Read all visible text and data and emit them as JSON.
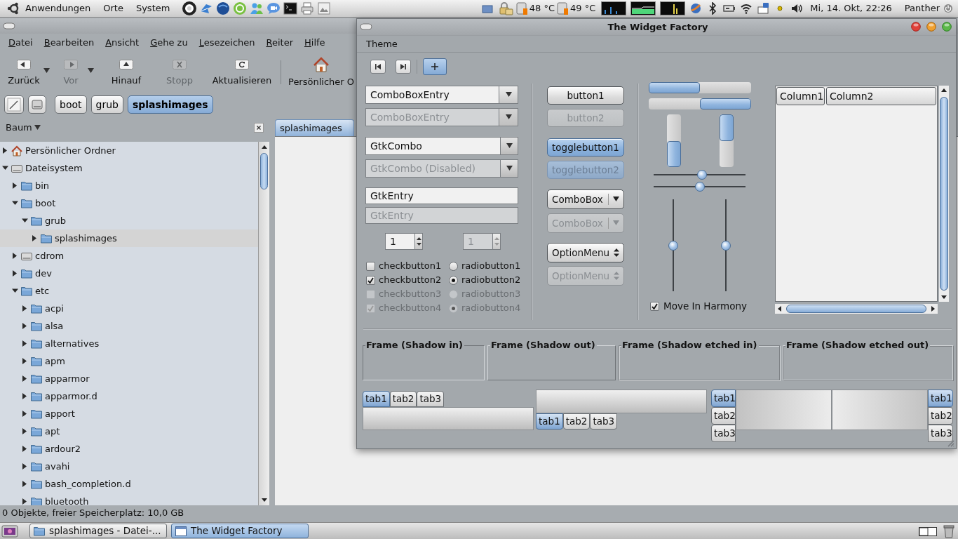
{
  "top_panel": {
    "menus": [
      "Anwendungen",
      "Orte",
      "System"
    ],
    "sensors": [
      "48 °C",
      "49 °C"
    ],
    "clock": "Mi, 14. Okt, 22:26",
    "user": "Panther"
  },
  "file_manager": {
    "menu": [
      "Datei",
      "Bearbeiten",
      "Ansicht",
      "Gehe zu",
      "Lesezeichen",
      "Reiter",
      "Hilfe"
    ],
    "toolbar": [
      {
        "kind": "back",
        "label": "Zurück",
        "disabled": false,
        "dropdown": true
      },
      {
        "kind": "forward",
        "label": "Vor",
        "disabled": true,
        "dropdown": true
      },
      {
        "kind": "up",
        "label": "Hinauf",
        "disabled": false,
        "dropdown": false
      },
      {
        "kind": "stop",
        "label": "Stopp",
        "disabled": true,
        "dropdown": false
      },
      {
        "kind": "reload",
        "label": "Aktualisieren",
        "disabled": false,
        "dropdown": false
      },
      {
        "kind": "home",
        "label": "Persönlicher O",
        "disabled": false,
        "dropdown": false
      }
    ],
    "path": [
      {
        "label": "boot",
        "selected": false
      },
      {
        "label": "grub",
        "selected": false
      },
      {
        "label": "splashimages",
        "selected": true
      }
    ],
    "sidebar": {
      "title": "Baum",
      "tree": [
        {
          "label": "Persönlicher Ordner",
          "kind": "home",
          "expanded": false,
          "selected": false
        },
        {
          "label": "Dateisystem",
          "kind": "drive",
          "expanded": true,
          "selected": false,
          "children": [
            {
              "label": "bin",
              "kind": "folder",
              "expanded": false,
              "selected": false
            },
            {
              "label": "boot",
              "kind": "folder",
              "expanded": true,
              "selected": false,
              "children": [
                {
                  "label": "grub",
                  "kind": "folder",
                  "expanded": true,
                  "selected": false,
                  "children": [
                    {
                      "label": "splashimages",
                      "kind": "folder",
                      "expanded": false,
                      "selected": true
                    }
                  ]
                }
              ]
            },
            {
              "label": "cdrom",
              "kind": "drive",
              "expanded": false,
              "selected": false
            },
            {
              "label": "dev",
              "kind": "folder",
              "expanded": false,
              "selected": false
            },
            {
              "label": "etc",
              "kind": "folder",
              "expanded": true,
              "selected": false,
              "children": [
                {
                  "label": "acpi",
                  "kind": "folder",
                  "expanded": false,
                  "selected": false
                },
                {
                  "label": "alsa",
                  "kind": "folder",
                  "expanded": false,
                  "selected": false
                },
                {
                  "label": "alternatives",
                  "kind": "folder",
                  "expanded": false,
                  "selected": false
                },
                {
                  "label": "apm",
                  "kind": "folder",
                  "expanded": false,
                  "selected": false
                },
                {
                  "label": "apparmor",
                  "kind": "folder",
                  "expanded": false,
                  "selected": false
                },
                {
                  "label": "apparmor.d",
                  "kind": "folder",
                  "expanded": false,
                  "selected": false
                },
                {
                  "label": "apport",
                  "kind": "folder",
                  "expanded": false,
                  "selected": false
                },
                {
                  "label": "apt",
                  "kind": "folder",
                  "expanded": false,
                  "selected": false
                },
                {
                  "label": "ardour2",
                  "kind": "folder",
                  "expanded": false,
                  "selected": false
                },
                {
                  "label": "avahi",
                  "kind": "folder",
                  "expanded": false,
                  "selected": false
                },
                {
                  "label": "bash_completion.d",
                  "kind": "folder",
                  "expanded": false,
                  "selected": false
                },
                {
                  "label": "bluetooth",
                  "kind": "folder",
                  "expanded": false,
                  "selected": false
                }
              ]
            }
          ]
        }
      ]
    },
    "tab": "splashimages",
    "status": "0 Objekte, freier Speicherplatz: 10,0 GB"
  },
  "widget_factory": {
    "title": "The Widget Factory",
    "menu": [
      "Theme"
    ],
    "toolbar": [
      {
        "kind": "first",
        "pressed": false
      },
      {
        "kind": "last",
        "pressed": false
      },
      {
        "kind": "add",
        "pressed": true
      }
    ],
    "combos": [
      {
        "kind": "combo_entry",
        "value": "ComboBoxEntry",
        "disabled": false
      },
      {
        "kind": "combo_entry",
        "value": "ComboBoxEntry",
        "disabled": true
      },
      {
        "kind": "combo",
        "value": "GtkCombo",
        "disabled": false
      },
      {
        "kind": "combo",
        "value": "GtkCombo (Disabled)",
        "disabled": true
      }
    ],
    "entries": [
      {
        "value": "GtkEntry",
        "disabled": false
      },
      {
        "value": "GtkEntry",
        "disabled": true
      }
    ],
    "spinners": [
      {
        "value": "1",
        "disabled": false
      },
      {
        "value": "1",
        "disabled": true
      }
    ],
    "checkbuttons": [
      {
        "label": "checkbutton1",
        "checked": false,
        "disabled": false
      },
      {
        "label": "checkbutton2",
        "checked": true,
        "disabled": false
      },
      {
        "label": "checkbutton3",
        "checked": false,
        "disabled": true
      },
      {
        "label": "checkbutton4",
        "checked": true,
        "disabled": true
      }
    ],
    "radiobuttons": [
      {
        "label": "radiobutton1",
        "selected": false,
        "disabled": false
      },
      {
        "label": "radiobutton2",
        "selected": true,
        "disabled": false
      },
      {
        "label": "radiobutton3",
        "selected": false,
        "disabled": true
      },
      {
        "label": "radiobutton4",
        "selected": true,
        "disabled": true
      }
    ],
    "buttons": [
      {
        "kind": "button",
        "label": "button1",
        "disabled": false,
        "pressed": false
      },
      {
        "kind": "button",
        "label": "button2",
        "disabled": true,
        "pressed": false
      },
      {
        "kind": "toggle",
        "label": "togglebutton1",
        "disabled": false,
        "pressed": true
      },
      {
        "kind": "toggle",
        "label": "togglebutton2",
        "disabled": true,
        "pressed": true
      },
      {
        "kind": "combobox",
        "label": "ComboBox",
        "disabled": false,
        "pressed": false
      },
      {
        "kind": "combobox",
        "label": "ComboBox",
        "disabled": true,
        "pressed": false
      },
      {
        "kind": "optionmenu",
        "label": "OptionMenu",
        "disabled": false,
        "pressed": false
      },
      {
        "kind": "optionmenu",
        "label": "OptionMenu",
        "disabled": true,
        "pressed": false
      }
    ],
    "progress_bars": [
      {
        "kind": "horizontal",
        "inverted": false,
        "level": 0.5
      },
      {
        "kind": "horizontal",
        "inverted": true,
        "level": 0.5
      },
      {
        "kind": "vertical",
        "inverted": true,
        "level": 0.5
      },
      {
        "kind": "vertical",
        "inverted": false,
        "level": 0.5
      }
    ],
    "scales": [
      {
        "kind": "horizontal",
        "level": 0.53
      },
      {
        "kind": "horizontal",
        "level": 0.5
      },
      {
        "kind": "vertical",
        "level": 0.5
      },
      {
        "kind": "vertical",
        "level": 0.5
      }
    ],
    "harmony": {
      "label": "Move In Harmony",
      "checked": true
    },
    "tree_view": {
      "columns": [
        "Column1",
        "Column2"
      ]
    },
    "frames": [
      {
        "label": "Frame (Shadow in)",
        "kind": "in"
      },
      {
        "label": "Frame (Shadow out)",
        "kind": "out"
      },
      {
        "label": "Frame (Shadow etched in)",
        "kind": "etched_in"
      },
      {
        "label": "Frame (Shadow etched out)",
        "kind": "etched_out"
      }
    ],
    "notebooks": [
      {
        "kind": "top",
        "tabs": [
          {
            "label": "tab1",
            "selected": true
          },
          {
            "label": "tab2",
            "selected": false
          },
          {
            "label": "tab3",
            "selected": false
          }
        ]
      },
      {
        "kind": "bottom",
        "tabs": [
          {
            "label": "tab1",
            "selected": true
          },
          {
            "label": "tab2",
            "selected": false
          },
          {
            "label": "tab3",
            "selected": false
          }
        ]
      },
      {
        "kind": "left",
        "tabs": [
          {
            "label": "tab1",
            "selected": true
          },
          {
            "label": "tab2",
            "selected": false
          },
          {
            "label": "tab3",
            "selected": false
          }
        ]
      },
      {
        "kind": "right",
        "tabs": [
          {
            "label": "tab1",
            "selected": true
          },
          {
            "label": "tab2",
            "selected": false
          },
          {
            "label": "tab3",
            "selected": false
          }
        ]
      }
    ]
  },
  "taskbar": [
    {
      "kind": "folder",
      "label": "splashimages - Datei-...",
      "selected": false
    },
    {
      "kind": "window",
      "label": "The Widget Factory",
      "selected": true
    }
  ]
}
